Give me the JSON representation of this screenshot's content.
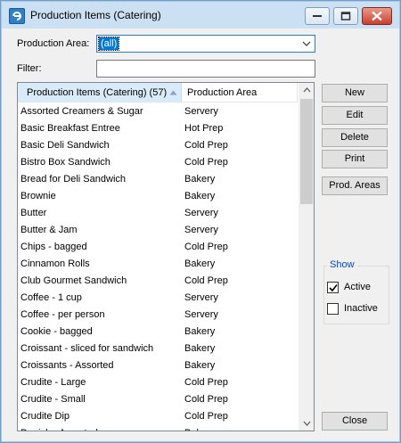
{
  "window": {
    "title": "Production Items (Catering)",
    "icon": "app-logo-icon",
    "controls": [
      "minimize-icon",
      "restore-icon",
      "close-icon"
    ]
  },
  "form": {
    "production_area_label": "Production Area:",
    "production_area_value": "(all)",
    "filter_label": "Filter:",
    "filter_value": ""
  },
  "grid": {
    "columns": [
      "Production Items (Catering) (57)",
      "Production Area"
    ],
    "sort_column": 0,
    "sort_direction": "ascending",
    "rows": [
      [
        "Assorted Creamers & Sugar",
        "Servery"
      ],
      [
        "Basic Breakfast Entree",
        "Hot Prep"
      ],
      [
        "Basic Deli Sandwich",
        "Cold Prep"
      ],
      [
        "Bistro Box Sandwich",
        "Cold Prep"
      ],
      [
        "Bread for Deli Sandwich",
        "Bakery"
      ],
      [
        "Brownie",
        "Bakery"
      ],
      [
        "Butter",
        "Servery"
      ],
      [
        "Butter & Jam",
        "Servery"
      ],
      [
        "Chips - bagged",
        "Cold Prep"
      ],
      [
        "Cinnamon Rolls",
        "Bakery"
      ],
      [
        "Club Gourmet Sandwich",
        "Cold Prep"
      ],
      [
        "Coffee - 1 cup",
        "Servery"
      ],
      [
        "Coffee - per person",
        "Servery"
      ],
      [
        "Cookie - bagged",
        "Bakery"
      ],
      [
        "Croissant - sliced for sandwich",
        "Bakery"
      ],
      [
        "Croissants - Assorted",
        "Bakery"
      ],
      [
        "Crudite - Large",
        "Cold Prep"
      ],
      [
        "Crudite - Small",
        "Cold Prep"
      ],
      [
        "Crudite Dip",
        "Cold Prep"
      ],
      [
        "Danish - Assorted",
        "Bakery"
      ]
    ]
  },
  "buttons": {
    "new": "New",
    "edit": "Edit",
    "delete": "Delete",
    "print": "Print",
    "prod_areas": "Prod. Areas",
    "close": "Close"
  },
  "show": {
    "title": "Show",
    "active_label": "Active",
    "active_checked": true,
    "inactive_label": "Inactive",
    "inactive_checked": false
  },
  "colors": {
    "titlebar": "#cce0f3",
    "selection": "#0078d7",
    "header_sorted": "#d9ebf9",
    "groupbox_title": "#0046d5"
  }
}
